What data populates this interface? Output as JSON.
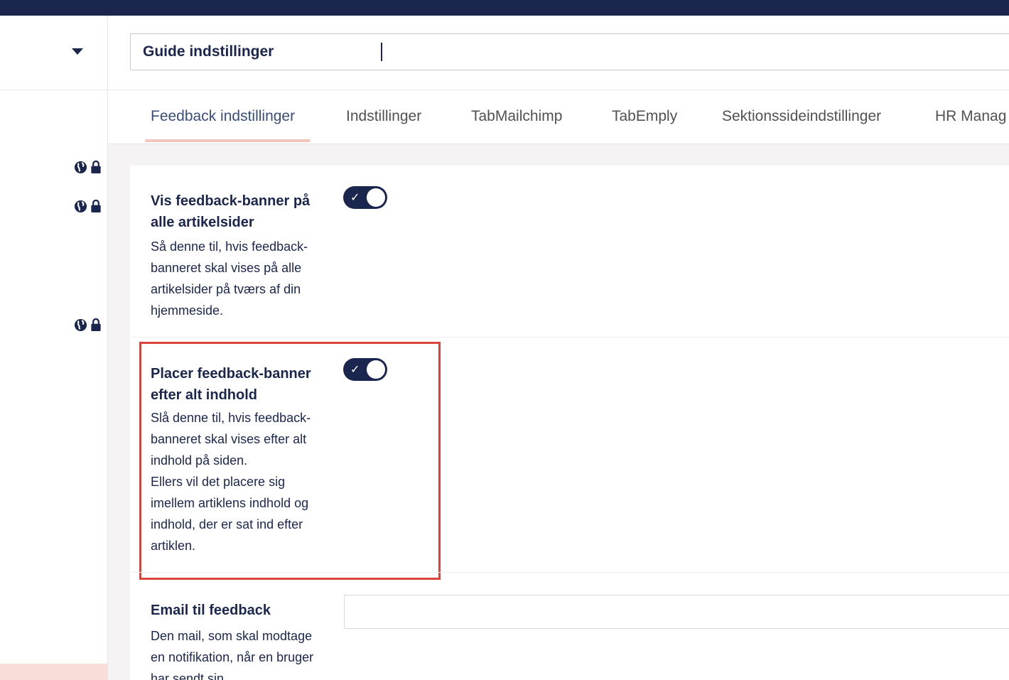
{
  "header": {
    "name_value": "Guide indstillinger"
  },
  "tabs": [
    {
      "label": "Feedback indstillinger",
      "active": true
    },
    {
      "label": "Indstillinger",
      "active": false
    },
    {
      "label": "TabMailchimp",
      "active": false
    },
    {
      "label": "TabEmply",
      "active": false
    },
    {
      "label": "Sektionssideindstillinger",
      "active": false
    },
    {
      "label": "HR Manag",
      "active": false
    }
  ],
  "properties": [
    {
      "title": "Vis feedback-banner på alle artikelsider",
      "description": "Så denne til, hvis feedback-banneret skal vises på alle artikelsider på tværs af din hjemmeside.",
      "toggle_on": true
    },
    {
      "title": "Placer feedback-banner efter alt indhold",
      "description": "Slå denne til, hvis feedback-banneret skal vises efter alt indhold på siden.\nEllers vil det placere sig imellem artiklens indhold og indhold, der er sat ind efter artiklen.",
      "toggle_on": true
    },
    {
      "title": "Email til feedback",
      "description": "Den mail, som skal modtage en notifikation, når en bruger har sendt sin",
      "input_value": ""
    }
  ],
  "icons": {
    "toggle_check": "✓",
    "variant": "globe-icon",
    "lock": "lock-icon"
  },
  "colors": {
    "navy": "#1b264f",
    "highlight": "#d9453a",
    "tab_underline": "#f5c4bf"
  }
}
